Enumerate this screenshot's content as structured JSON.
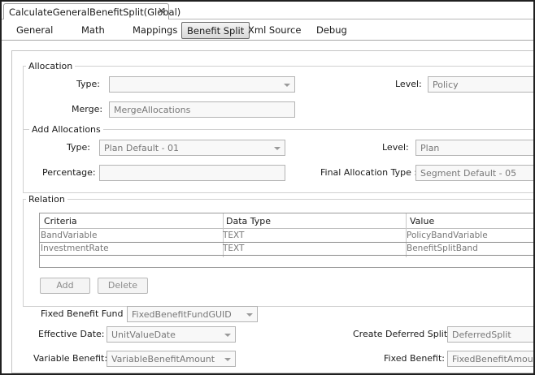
{
  "editor_tab": {
    "title": "CalculateGeneralBenefitSplit(Global)",
    "close_glyph": "✕"
  },
  "subtabs": [
    "General",
    "Math",
    "Mappings",
    "Benefit Split",
    "Xml Source",
    "Debug"
  ],
  "active_subtab": "Benefit Split",
  "allocation": {
    "title": "Allocation",
    "type_label": "Type:",
    "type_value": "",
    "level_label": "Level:",
    "level_value": "Policy",
    "merge_label": "Merge:",
    "merge_value": "MergeAllocations"
  },
  "add_allocations": {
    "title": "Add Allocations",
    "type_label": "Type:",
    "type_value": "Plan Default - 01",
    "level_label": "Level:",
    "level_value": "Plan",
    "percentage_label": "Percentage:",
    "percentage_value": "",
    "final_type_label": "Final Allocation Type :",
    "final_type_value": "Segment Default - 05"
  },
  "relation": {
    "title": "Relation",
    "columns": [
      "Criteria",
      "Data Type",
      "Value"
    ],
    "rows": [
      [
        "BandVariable",
        "TEXT",
        "PolicyBandVariable"
      ],
      [
        "InvestmentRate",
        "TEXT",
        "BenefitSplitBand"
      ]
    ],
    "add_label": "Add",
    "delete_label": "Delete"
  },
  "fixed_benefit_fund": {
    "label": "Fixed Benefit Fund :",
    "value": "FixedBenefitFundGUID"
  },
  "effective_date": {
    "label": "Effective Date:",
    "value": "UnitValueDate"
  },
  "create_deferred_split": {
    "label": "Create Deferred Split:",
    "value": "DeferredSplit"
  },
  "variable_benefit": {
    "label": "Variable Benefit:",
    "value": "VariableBenefitAmount"
  },
  "fixed_benefit": {
    "label": "Fixed Benefit:",
    "value": "FixedBenefitAmount"
  }
}
